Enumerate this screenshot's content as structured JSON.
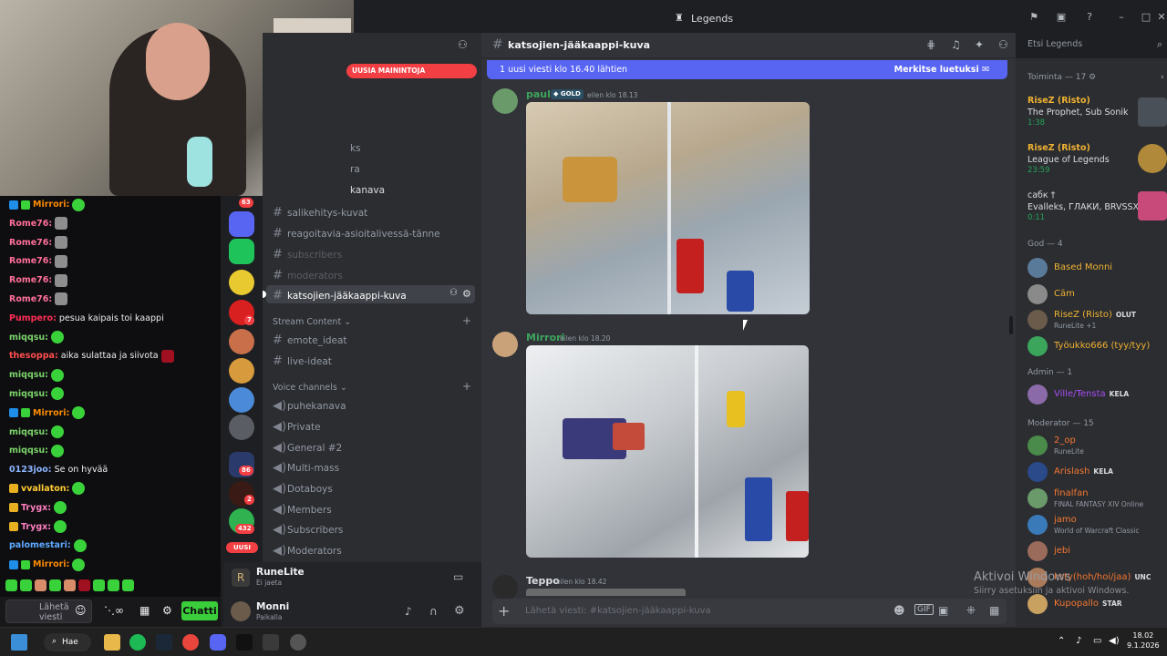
{
  "window": {
    "title": "Legends"
  },
  "chat": {
    "lines": [
      {
        "user": "Mirrori:",
        "text": "",
        "color": "#ff8c00",
        "badges": [
          "vip",
          "sub"
        ],
        "emotes": [
          "green"
        ]
      },
      {
        "user": "Rome76:",
        "text": "",
        "color": "#ff6f9a",
        "badges": [],
        "emotes": [
          "gray"
        ]
      },
      {
        "user": "Rome76:",
        "text": "",
        "color": "#ff6f9a",
        "badges": [],
        "emotes": [
          "gray"
        ]
      },
      {
        "user": "Rome76:",
        "text": "",
        "color": "#ff6f9a",
        "badges": [],
        "emotes": [
          "gray"
        ]
      },
      {
        "user": "Rome76:",
        "text": "",
        "color": "#ff6f9a",
        "badges": [],
        "emotes": [
          "gray"
        ]
      },
      {
        "user": "Rome76:",
        "text": "",
        "color": "#ff6f9a",
        "badges": [],
        "emotes": [
          "gray"
        ]
      },
      {
        "user": "Pumpero:",
        "text": "pesua kaipais toi kaappi",
        "color": "#ff2d55",
        "badges": [],
        "emotes": []
      },
      {
        "user": "miqqsu:",
        "text": "",
        "color": "#7cd36b",
        "badges": [],
        "emotes": [
          "green"
        ]
      },
      {
        "user": "thesoppa:",
        "text": "aika sulattaa ja siivota",
        "color": "#ff4d4d",
        "badges": [],
        "emotes": [
          "red"
        ]
      },
      {
        "user": "miqqsu:",
        "text": "",
        "color": "#7cd36b",
        "badges": [],
        "emotes": [
          "green"
        ]
      },
      {
        "user": "miqqsu:",
        "text": "",
        "color": "#7cd36b",
        "badges": [],
        "emotes": [
          "green"
        ]
      },
      {
        "user": "Mirrori:",
        "text": "",
        "color": "#ff8c00",
        "badges": [
          "vip",
          "sub"
        ],
        "emotes": [
          "green"
        ]
      },
      {
        "user": "miqqsu:",
        "text": "",
        "color": "#7cd36b",
        "badges": [],
        "emotes": [
          "green"
        ]
      },
      {
        "user": "miqqsu:",
        "text": "",
        "color": "#7cd36b",
        "badges": [],
        "emotes": [
          "green"
        ]
      },
      {
        "user": "0123joo:",
        "text": "Se on hyvää",
        "color": "#8ab4ff",
        "badges": [],
        "emotes": []
      },
      {
        "user": "vvallaton:",
        "text": "",
        "color": "#ffcc33",
        "badges": [
          "crown"
        ],
        "emotes": [
          "green"
        ]
      },
      {
        "user": "Trygx:",
        "text": "",
        "color": "#ff7fbf",
        "badges": [
          "crown"
        ],
        "emotes": [
          "green"
        ]
      },
      {
        "user": "Trygx:",
        "text": "",
        "color": "#ff7fbf",
        "badges": [
          "crown"
        ],
        "emotes": [
          "green"
        ]
      },
      {
        "user": "palomestari:",
        "text": "",
        "color": "#5ea8ff",
        "badges": [],
        "emotes": [
          "green"
        ]
      },
      {
        "user": "Mirrori:",
        "text": "",
        "color": "#ff8c00",
        "badges": [
          "vip",
          "sub"
        ],
        "emotes": [
          "green"
        ]
      }
    ],
    "input_placeholder": "Lähetä viesti",
    "send_label": "Chatti"
  },
  "servers": {
    "badges": [
      "63",
      "7",
      "86",
      "2",
      "432"
    ],
    "new_label": "UUSI"
  },
  "channels": {
    "mentions_label": "UUSIA MAININTOJA",
    "partial": [
      "ks",
      "ra",
      "kanava"
    ],
    "list": [
      {
        "name": "salikehitys-kuvat",
        "state": "normal"
      },
      {
        "name": "reagoitavia-asioitalivessä-tänne",
        "state": "normal"
      },
      {
        "name": "subscribers",
        "state": "muted"
      },
      {
        "name": "moderators",
        "state": "muted"
      },
      {
        "name": "katsojien-jääkaappi-kuva",
        "state": "selected"
      }
    ],
    "stream_category": "Stream Content",
    "stream": [
      "emote_ideat",
      "live-ideat"
    ],
    "voice_category": "Voice channels",
    "voice": [
      "puhekanava",
      "Private",
      "General #2",
      "Multi-mass",
      "Dotaboys",
      "Members",
      "Subscribers",
      "Moderators"
    ]
  },
  "userpanel": {
    "activity_name": "RuneLite",
    "activity_status": "Ei jaeta",
    "user_name": "Monni",
    "user_status": "Paikalla"
  },
  "main": {
    "channel_name": "katsojien-jääkaappi-kuva",
    "new_banner": "1 uusi viesti klo 16.40 lähtien",
    "mark_read": "Merkitse luetuksi",
    "messages": [
      {
        "author": "pauli",
        "tag": "GOLD",
        "time": "eilen klo 18.13",
        "color": "#3ba55c"
      },
      {
        "author": "Mirrori",
        "tag": "",
        "time": "eilen klo 18.20",
        "color": "#3ba55c"
      },
      {
        "author": "Teppo",
        "tag": "",
        "time": "eilen klo 18.42",
        "color": "#dbdee1"
      }
    ],
    "input_placeholder": "Lähetä viesti: #katsojien-jääkaappi-kuva"
  },
  "members": {
    "search_placeholder": "Etsi Legends",
    "activity_header": "Toiminta — 17",
    "activities": [
      {
        "name": "RiseZ (Risto)",
        "detail": "The Prophet, Sub Sonik",
        "time": "1:38"
      },
      {
        "name": "RiseZ (Risto)",
        "detail": "League of Legends",
        "time": "23:59"
      },
      {
        "name": "сабк †",
        "detail": "Evalleks, ГЛАКИ, BRVSSXK",
        "time": "0:11"
      }
    ],
    "god_header": "God — 4",
    "god": [
      {
        "name": "Based Monni",
        "status": "",
        "tag": "",
        "color": "#f0b232"
      },
      {
        "name": "Cäm",
        "status": "",
        "tag": "",
        "color": "#f0b232"
      },
      {
        "name": "RiseZ (Risto)",
        "status": "RuneLite +1",
        "tag": "OLUT",
        "color": "#f0b232"
      },
      {
        "name": "Työukko666 (tyy/tyy)",
        "status": "",
        "tag": "",
        "color": "#f0b232"
      }
    ],
    "admin_header": "Admin — 1",
    "admin": [
      {
        "name": "Ville/Tensta",
        "status": "",
        "tag": "KELA",
        "color": "#a84df5"
      }
    ],
    "mod_header": "Moderator — 15",
    "mods": [
      {
        "name": "2_op",
        "status": "RuneLite",
        "tag": "",
        "color": "#f57731"
      },
      {
        "name": "Arislash",
        "status": "",
        "tag": "KELA",
        "color": "#f57731"
      },
      {
        "name": "finalfan",
        "status": "FINAL FANTASY XIV Online",
        "tag": "",
        "color": "#f57731"
      },
      {
        "name": "jamo",
        "status": "World of Warcraft Classic",
        "tag": "",
        "color": "#f57731"
      },
      {
        "name": "jebi",
        "status": "",
        "tag": "",
        "color": "#f57731"
      },
      {
        "name": "ksty(hoh/hoi/jaa)",
        "status": "",
        "tag": "UNC",
        "color": "#f57731"
      },
      {
        "name": "Kupopallo",
        "status": "",
        "tag": "STAR",
        "color": "#f57731"
      }
    ]
  },
  "overlay": {
    "activate_title": "Aktivoi Windows",
    "activate_sub": "Siirry asetuksiin ja aktivoi Windows."
  },
  "taskbar": {
    "search_label": "Hae",
    "time": "18.02",
    "date": "9.1.2026"
  }
}
